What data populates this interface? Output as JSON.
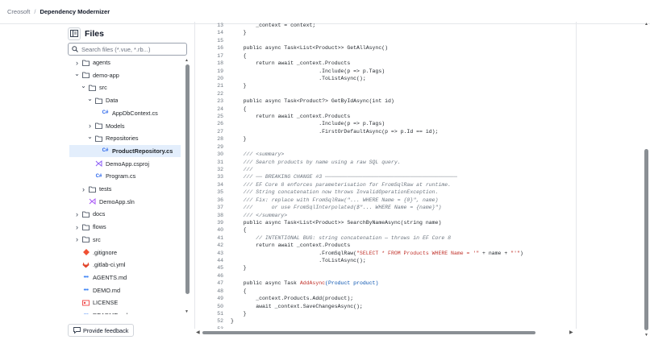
{
  "breadcrumb": {
    "root": "Creosoft",
    "separator": "/",
    "current": "Dependency Modernizer"
  },
  "sidebar": {
    "title": "Files",
    "search_placeholder": "Search files (*.vue, *.rb...)",
    "feedback_label": "Provide feedback",
    "tree": [
      {
        "label": "agents",
        "type": "folder",
        "depth": 0,
        "expanded": false
      },
      {
        "label": "demo-app",
        "type": "folder",
        "depth": 0,
        "expanded": true
      },
      {
        "label": "src",
        "type": "folder",
        "depth": 1,
        "expanded": true
      },
      {
        "label": "Data",
        "type": "folder",
        "depth": 2,
        "expanded": true
      },
      {
        "label": "AppDbContext.cs",
        "type": "cs",
        "depth": 3
      },
      {
        "label": "Models",
        "type": "folder",
        "depth": 2,
        "expanded": false
      },
      {
        "label": "Repositories",
        "type": "folder",
        "depth": 2,
        "expanded": true
      },
      {
        "label": "ProductRepository.cs",
        "type": "cs",
        "depth": 3,
        "selected": true
      },
      {
        "label": "DemoApp.csproj",
        "type": "csproj",
        "depth": 2
      },
      {
        "label": "Program.cs",
        "type": "cs",
        "depth": 2
      },
      {
        "label": "tests",
        "type": "folder",
        "depth": 1,
        "expanded": false
      },
      {
        "label": "DemoApp.sln",
        "type": "sln",
        "depth": 1
      },
      {
        "label": "docs",
        "type": "folder",
        "depth": 0,
        "expanded": false
      },
      {
        "label": "flows",
        "type": "folder",
        "depth": 0,
        "expanded": false
      },
      {
        "label": "src",
        "type": "folder",
        "depth": 0,
        "expanded": false
      },
      {
        "label": ".gitignore",
        "type": "git",
        "depth": 0
      },
      {
        "label": ".gitlab-ci.yml",
        "type": "gitlab",
        "depth": 0
      },
      {
        "label": "AGENTS.md",
        "type": "md",
        "depth": 0
      },
      {
        "label": "DEMO.md",
        "type": "md",
        "depth": 0
      },
      {
        "label": "LICENSE",
        "type": "license",
        "depth": 0
      },
      {
        "label": "README.md",
        "type": "md",
        "depth": 0
      }
    ]
  },
  "editor": {
    "lines": [
      {
        "n": "13",
        "t": "        _context = context;",
        "k": "plain"
      },
      {
        "n": "14",
        "t": "    }",
        "k": "plain"
      },
      {
        "n": "15",
        "t": "",
        "k": "plain"
      },
      {
        "n": "16",
        "t": "    public async Task<List<Product>> GetAllAsync()",
        "k": "plain"
      },
      {
        "n": "17",
        "t": "    {",
        "k": "plain"
      },
      {
        "n": "18",
        "t": "        return await _context.Products",
        "k": "plain"
      },
      {
        "n": "19",
        "t": "                            .Include(p => p.Tags)",
        "k": "plain"
      },
      {
        "n": "20",
        "t": "                            .ToListAsync();",
        "k": "plain"
      },
      {
        "n": "21",
        "t": "    }",
        "k": "plain"
      },
      {
        "n": "22",
        "t": "",
        "k": "plain"
      },
      {
        "n": "23",
        "t": "    public async Task<Product?> GetByIdAsync(int id)",
        "k": "plain"
      },
      {
        "n": "24",
        "t": "    {",
        "k": "plain"
      },
      {
        "n": "25",
        "t": "        return await _context.Products",
        "k": "plain"
      },
      {
        "n": "26",
        "t": "                            .Include(p => p.Tags)",
        "k": "plain"
      },
      {
        "n": "27",
        "t": "                            .FirstOrDefaultAsync(p => p.Id == id);",
        "k": "plain"
      },
      {
        "n": "28",
        "t": "    }",
        "k": "plain"
      },
      {
        "n": "29",
        "t": "",
        "k": "plain"
      },
      {
        "n": "30",
        "t": "    /// <summary>",
        "k": "comment"
      },
      {
        "n": "31",
        "t": "    /// Search products by name using a raw SQL query.",
        "k": "comment"
      },
      {
        "n": "32",
        "t": "    ///",
        "k": "comment"
      },
      {
        "n": "33",
        "t": "    /// ── BREAKING CHANGE #3 ──────────────────────────────────────────",
        "k": "comment"
      },
      {
        "n": "34",
        "t": "    /// EF Core 8 enforces parameterisation for FromSqlRaw at runtime.",
        "k": "comment"
      },
      {
        "n": "35",
        "t": "    /// String concatenation now throws InvalidOperationException.",
        "k": "comment"
      },
      {
        "n": "36",
        "t": "    /// Fix: replace with FromSqlRaw(\"... WHERE Name = {0}\", name)",
        "k": "comment"
      },
      {
        "n": "37",
        "t": "    ///      or use FromSqlInterpolated($\"... WHERE Name = {name}\")",
        "k": "comment"
      },
      {
        "n": "38",
        "t": "    /// </summary>",
        "k": "comment"
      },
      {
        "n": "39",
        "t": "    public async Task<List<Product>> SearchByNameAsync(string name)",
        "k": "plain"
      },
      {
        "n": "40",
        "t": "    {",
        "k": "plain"
      },
      {
        "n": "41",
        "t": "        // INTENTIONAL BUG: string concatenation — throws in EF Core 8",
        "k": "comment"
      },
      {
        "n": "42",
        "t": "        return await _context.Products",
        "k": "plain"
      },
      {
        "n": "43",
        "t": "                            .FromSqlRaw(",
        "k": "sql",
        "s": "\"SELECT * FROM Products WHERE Name = '\"",
        "r": " + name + ",
        "s2": "\"'\"",
        "e": ")"
      },
      {
        "n": "44",
        "t": "                            .ToListAsync();",
        "k": "plain"
      },
      {
        "n": "45",
        "t": "    }",
        "k": "plain"
      },
      {
        "n": "46",
        "t": "",
        "k": "plain"
      },
      {
        "n": "47",
        "t": "    public async Task ",
        "k": "add",
        "f": "AddAsync",
        "p": "(Product product)"
      },
      {
        "n": "48",
        "t": "    {",
        "k": "plain"
      },
      {
        "n": "49",
        "t": "        _context.Products.Add(product);",
        "k": "plain"
      },
      {
        "n": "50",
        "t": "        await _context.SaveChangesAsync();",
        "k": "plain"
      },
      {
        "n": "51",
        "t": "    }",
        "k": "plain"
      },
      {
        "n": "52",
        "t": "}",
        "k": "plain"
      },
      {
        "n": "53",
        "t": "",
        "k": "plain"
      }
    ]
  },
  "colors": {
    "selected_row": "#e3eefc",
    "comment": "#6e7781",
    "string": "#c0312a",
    "type": "#0550ae"
  }
}
